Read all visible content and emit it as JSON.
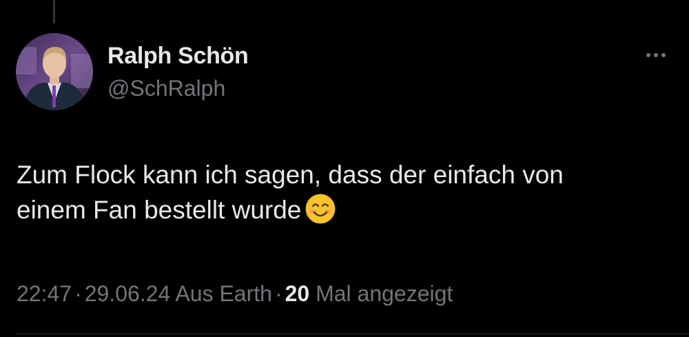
{
  "author": {
    "name": "Ralph Schön",
    "handle": "@SchRalph"
  },
  "tweet": {
    "text_line1": "Zum Flock kann ich sagen, dass der einfach von",
    "text_line2": "einem Fan bestellt wurde"
  },
  "meta": {
    "time": "22:47",
    "date": "29.06.24",
    "location": "Aus Earth",
    "view_count": "20",
    "view_label": "Mal angezeigt",
    "separator": "·"
  },
  "colors": {
    "background": "#000000",
    "primary_text": "#e7e9ea",
    "secondary_text": "#71767b"
  },
  "icons": {
    "more": "more-horizontal-icon",
    "emoji": "smiling-face-emoji"
  }
}
